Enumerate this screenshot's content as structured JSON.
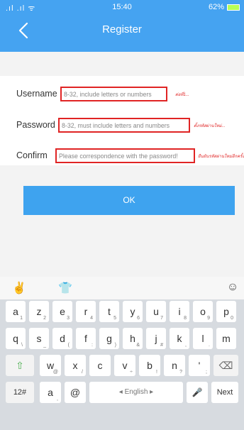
{
  "status": {
    "signal": ".ıl .ıl ᯤ",
    "time": "15:40",
    "battery": "62%"
  },
  "header": {
    "title": "Register"
  },
  "form": {
    "username": {
      "label": "Username",
      "placeholder": "8-32, include letters or numbers",
      "hint": "ต่อที่1..."
    },
    "password": {
      "label": "Password",
      "placeholder": "8-32, must include letters and numbers",
      "hint": "ตั้งรหัสผ่านใหม่..."
    },
    "confirm": {
      "label": "Confirm",
      "placeholder": "Please correspondence with the password!",
      "hint": "ยืนยันรหัสผ่านใหม่อีกครั้ง..."
    }
  },
  "ok_label": "OK",
  "keyboard": {
    "row1": [
      {
        "k": "a",
        "s": "1"
      },
      {
        "k": "z",
        "s": "2"
      },
      {
        "k": "e",
        "s": "3"
      },
      {
        "k": "r",
        "s": "4"
      },
      {
        "k": "t",
        "s": "5"
      },
      {
        "k": "y",
        "s": "6"
      },
      {
        "k": "u",
        "s": "7"
      },
      {
        "k": "i",
        "s": "8"
      },
      {
        "k": "o",
        "s": "9"
      },
      {
        "k": "p",
        "s": "0"
      }
    ],
    "row2": [
      {
        "k": "q",
        "s": "\\"
      },
      {
        "k": "s",
        "s": "_"
      },
      {
        "k": "d",
        "s": "("
      },
      {
        "k": "f",
        "s": ":"
      },
      {
        "k": "g",
        "s": ")"
      },
      {
        "k": "h",
        "s": "&"
      },
      {
        "k": "j",
        "s": "#"
      },
      {
        "k": "k",
        "s": ","
      },
      {
        "k": "l",
        "s": "."
      },
      {
        "k": "m",
        "s": ""
      }
    ],
    "row3": [
      {
        "k": "⇧",
        "s": ""
      },
      {
        "k": "w",
        "s": "@"
      },
      {
        "k": "x",
        "s": "/"
      },
      {
        "k": "c",
        "s": ""
      },
      {
        "k": "v",
        "s": "÷"
      },
      {
        "k": "b",
        "s": "!"
      },
      {
        "k": "n",
        "s": "?"
      },
      {
        "k": "'",
        "s": ";"
      },
      {
        "k": "⌫",
        "s": ""
      }
    ],
    "row4": {
      "k12": "12#",
      "ka": "a",
      "ka_sub": ",",
      "kat": "@",
      "space": "◂ English ▸",
      "mic": "🎤",
      "dot": ".",
      "next": "Next"
    }
  }
}
